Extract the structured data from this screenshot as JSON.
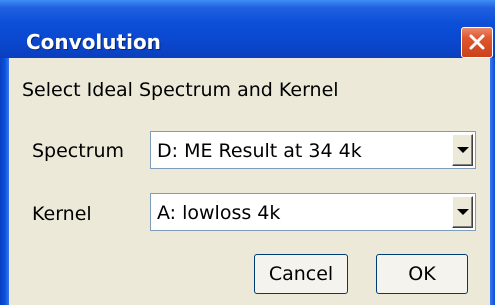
{
  "window": {
    "title": "Convolution",
    "prompt": "Select Ideal Spectrum and Kernel"
  },
  "spectrum": {
    "label": "Spectrum",
    "selected": "D: ME Result at 34  4k"
  },
  "kernel": {
    "label": "Kernel",
    "selected": "A: lowloss  4k"
  },
  "buttons": {
    "cancel": "Cancel",
    "ok": "OK"
  },
  "icons": {
    "close": "close-icon",
    "dropdown": "chevron-down-icon"
  },
  "colors": {
    "titlebar": "#0a48cf",
    "close_button": "#e0562f",
    "dialog_background": "#ece9d8"
  }
}
